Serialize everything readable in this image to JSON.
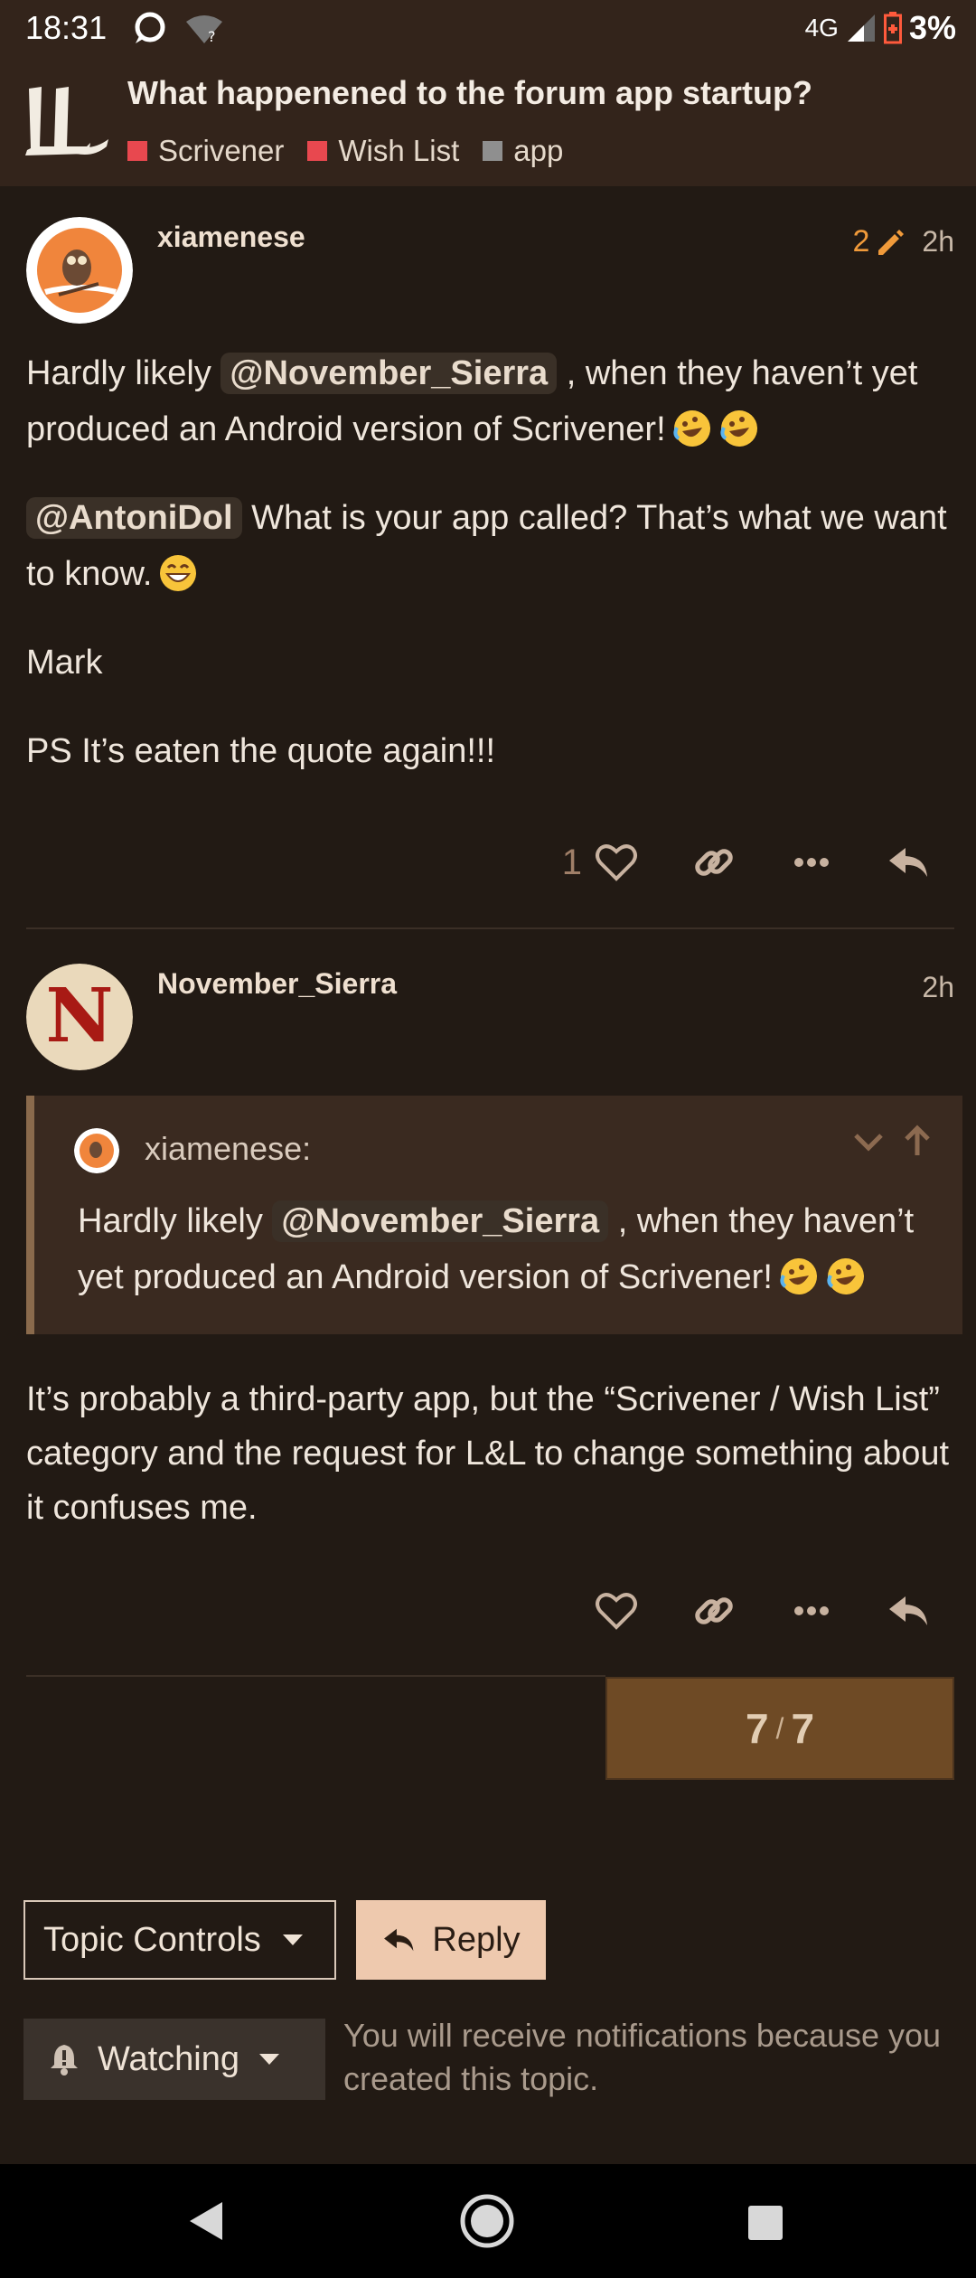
{
  "status_bar": {
    "time": "18:31",
    "network": "4G",
    "battery": "3%",
    "icons": [
      "chat-notification-icon",
      "wifi-unknown-icon",
      "signal-icon",
      "battery-low-icon"
    ]
  },
  "header": {
    "title": "What happenened to the forum app startup?",
    "categories": [
      {
        "label": "Scrivener",
        "color": "#e8484f"
      },
      {
        "label": "Wish List",
        "color": "#e8484f"
      },
      {
        "label": "app",
        "color": "#8f8f8f"
      }
    ]
  },
  "posts": [
    {
      "username": "xiamenese",
      "edits": "2",
      "age": "2h",
      "mention1": "@November_Sierra",
      "p1_before": "Hardly likely ",
      "p1_after": " , when they haven’t yet produced an Android version of Scrivener!",
      "mention2": "@AntoniDol",
      "p2_after": " What is your app called? That’s what we want to know.",
      "p3": "Mark",
      "p4": "PS It’s eaten the quote again!!!",
      "likes": "1"
    },
    {
      "username": "November_Sierra",
      "age": "2h",
      "quote": {
        "user": "xiamenese:",
        "before": "Hardly likely ",
        "mention": "@November_Sierra",
        "after": " , when they haven’t yet produced an Android version of Scrivener!"
      },
      "p1": "It’s probably a third-party app, but the “Scrivener / Wish List” category and the request for L&L to change something about it confuses me."
    }
  ],
  "progress": {
    "current": "7",
    "total": "7"
  },
  "footer": {
    "topic_controls": "Topic Controls",
    "reply": "Reply",
    "watching": "Watching",
    "watching_note": "You will receive notifications because you created this topic."
  },
  "colors": {
    "accent": "#f09a3a",
    "progress_bg": "#6e4a25",
    "reply_bg": "#eec9ae"
  }
}
